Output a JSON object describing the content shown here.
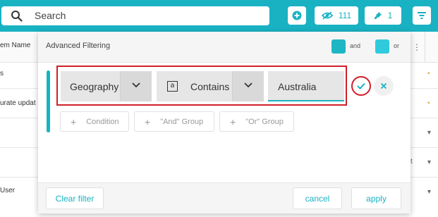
{
  "colors": {
    "accent": "#19b2c3",
    "highlight": "#d01f2a",
    "and_swatch": "#1fb6c4",
    "or_swatch": "#2fcbdc"
  },
  "topbar": {
    "search_placeholder": "Search",
    "hidden_count": "111",
    "pinned_count": "1",
    "icons": [
      "search-icon",
      "add-icon",
      "eye-off-icon",
      "pin-icon",
      "filter-icon"
    ]
  },
  "background_table": {
    "header_partial": "em Name",
    "rows_left": [
      "s",
      "urate updat",
      "User"
    ],
    "rows_right_glyphs": [
      "t"
    ]
  },
  "panel": {
    "title": "Advanced Filtering",
    "and_label": "and",
    "or_label": "or",
    "condition": {
      "field": "Geography",
      "operator_icon": "a",
      "operator": "Contains",
      "value": "Australia"
    },
    "add_buttons": {
      "condition": "Condition",
      "and_group": "\"And\" Group",
      "or_group": "\"Or\" Group"
    },
    "footer": {
      "clear": "Clear filter",
      "cancel": "cancel",
      "apply": "apply"
    }
  }
}
